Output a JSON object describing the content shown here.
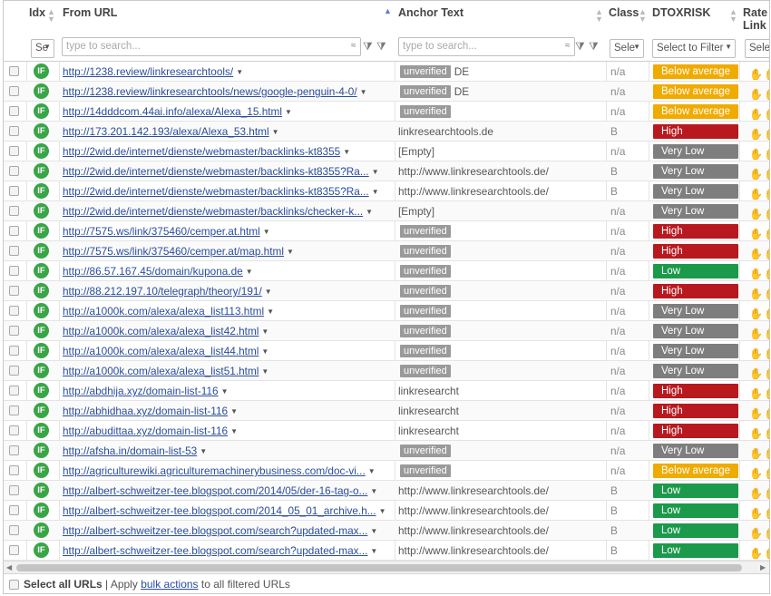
{
  "columns": {
    "idx": "Idx",
    "from_url": "From URL",
    "anchor_text": "Anchor Text",
    "class": "Class",
    "dtoxrisk": "DTOXRISK",
    "rate_link_1": "Rate",
    "rate_link_2": "Link"
  },
  "filters": {
    "idx_select": "Se",
    "url_placeholder": "type to search...",
    "anchor_placeholder": "type to search...",
    "class_select": "Sele",
    "dtox_select": "Select to Filter",
    "rate_select": "Sele"
  },
  "colors": {
    "below_average": "#f0ab00",
    "high": "#b8191f",
    "very_low": "#7e7e7e",
    "low": "#1a9a4a",
    "if_icon": "#3aa547",
    "link": "#2a4d9b"
  },
  "rows": [
    {
      "url": "http://1238.review/linkresearchtools/",
      "unverified": true,
      "anchor": "DE",
      "cls": "n/a",
      "risk": "Below average",
      "risk_type": "below_average"
    },
    {
      "url": "http://1238.review/linkresearchtools/news/google-penguin-4-0/",
      "unverified": true,
      "anchor": "DE",
      "cls": "n/a",
      "risk": "Below average",
      "risk_type": "below_average"
    },
    {
      "url": "http://14dddcom.44ai.info/alexa/Alexa_15.html",
      "unverified": true,
      "anchor": "",
      "cls": "n/a",
      "risk": "Below average",
      "risk_type": "below_average"
    },
    {
      "url": "http://173.201.142.193/alexa/Alexa_53.html",
      "unverified": false,
      "anchor": "linkresearchtools.de",
      "cls": "B",
      "risk": "High",
      "risk_type": "high"
    },
    {
      "url": "http://2wid.de/internet/dienste/webmaster/backlinks-kt8355",
      "unverified": false,
      "anchor": "[Empty]",
      "cls": "n/a",
      "risk": "Very Low",
      "risk_type": "very_low"
    },
    {
      "url": "http://2wid.de/internet/dienste/webmaster/backlinks-kt8355?Ra...",
      "unverified": false,
      "anchor": "http://www.linkresearchtools.de/",
      "cls": "B",
      "risk": "Very Low",
      "risk_type": "very_low"
    },
    {
      "url": "http://2wid.de/internet/dienste/webmaster/backlinks-kt8355?Ra...",
      "unverified": false,
      "anchor": "http://www.linkresearchtools.de/",
      "cls": "B",
      "risk": "Very Low",
      "risk_type": "very_low"
    },
    {
      "url": "http://2wid.de/internet/dienste/webmaster/backlinks/checker-k...",
      "unverified": false,
      "anchor": "[Empty]",
      "cls": "n/a",
      "risk": "Very Low",
      "risk_type": "very_low"
    },
    {
      "url": "http://7575.ws/link/375460/cemper.at.html",
      "unverified": true,
      "anchor": "",
      "cls": "n/a",
      "risk": "High",
      "risk_type": "high"
    },
    {
      "url": "http://7575.ws/link/375460/cemper.at/map.html",
      "unverified": true,
      "anchor": "",
      "cls": "n/a",
      "risk": "High",
      "risk_type": "high"
    },
    {
      "url": "http://86.57.167.45/domain/kupona.de",
      "unverified": true,
      "anchor": "",
      "cls": "n/a",
      "risk": "Low",
      "risk_type": "low"
    },
    {
      "url": "http://88.212.197.10/telegraph/theory/191/",
      "unverified": true,
      "anchor": "",
      "cls": "n/a",
      "risk": "High",
      "risk_type": "high"
    },
    {
      "url": "http://a1000k.com/alexa/alexa_list113.html",
      "unverified": true,
      "anchor": "",
      "cls": "n/a",
      "risk": "Very Low",
      "risk_type": "very_low"
    },
    {
      "url": "http://a1000k.com/alexa/alexa_list42.html",
      "unverified": true,
      "anchor": "",
      "cls": "n/a",
      "risk": "Very Low",
      "risk_type": "very_low"
    },
    {
      "url": "http://a1000k.com/alexa/alexa_list44.html",
      "unverified": true,
      "anchor": "",
      "cls": "n/a",
      "risk": "Very Low",
      "risk_type": "very_low"
    },
    {
      "url": "http://a1000k.com/alexa/alexa_list51.html",
      "unverified": true,
      "anchor": "",
      "cls": "n/a",
      "risk": "Very Low",
      "risk_type": "very_low"
    },
    {
      "url": "http://abdhija.xyz/domain-list-116",
      "unverified": false,
      "anchor": "linkresearcht",
      "cls": "n/a",
      "risk": "High",
      "risk_type": "high"
    },
    {
      "url": "http://abhidhaa.xyz/domain-list-116",
      "unverified": false,
      "anchor": "linkresearcht",
      "cls": "n/a",
      "risk": "High",
      "risk_type": "high"
    },
    {
      "url": "http://abudittaa.xyz/domain-list-116",
      "unverified": false,
      "anchor": "linkresearcht",
      "cls": "n/a",
      "risk": "High",
      "risk_type": "high"
    },
    {
      "url": "http://afsha.in/domain-list-53",
      "unverified": true,
      "anchor": "",
      "cls": "n/a",
      "risk": "Very Low",
      "risk_type": "very_low"
    },
    {
      "url": "http://agriculturewiki.agriculturemachinerybusiness.com/doc-vi...",
      "unverified": true,
      "anchor": "",
      "cls": "n/a",
      "risk": "Below average",
      "risk_type": "below_average"
    },
    {
      "url": "http://albert-schweitzer-tee.blogspot.com/2014/05/der-16-tag-o...",
      "unverified": false,
      "anchor": "http://www.linkresearchtools.de/",
      "cls": "B",
      "risk": "Low",
      "risk_type": "low"
    },
    {
      "url": "http://albert-schweitzer-tee.blogspot.com/2014_05_01_archive.h...",
      "unverified": false,
      "anchor": "http://www.linkresearchtools.de/",
      "cls": "B",
      "risk": "Low",
      "risk_type": "low"
    },
    {
      "url": "http://albert-schweitzer-tee.blogspot.com/search?updated-max...",
      "unverified": false,
      "anchor": "http://www.linkresearchtools.de/",
      "cls": "B",
      "risk": "Low",
      "risk_type": "low"
    },
    {
      "url": "http://albert-schweitzer-tee.blogspot.com/search?updated-max...",
      "unverified": false,
      "anchor": "http://www.linkresearchtools.de/",
      "cls": "B",
      "risk": "Low",
      "risk_type": "low"
    }
  ],
  "labels": {
    "unverified": "unverified",
    "if_icon": "IF"
  },
  "footer": {
    "select_all": "Select all URLs",
    "separator": " | Apply ",
    "bulk_actions": "bulk actions",
    "suffix": " to all filtered URLs"
  }
}
